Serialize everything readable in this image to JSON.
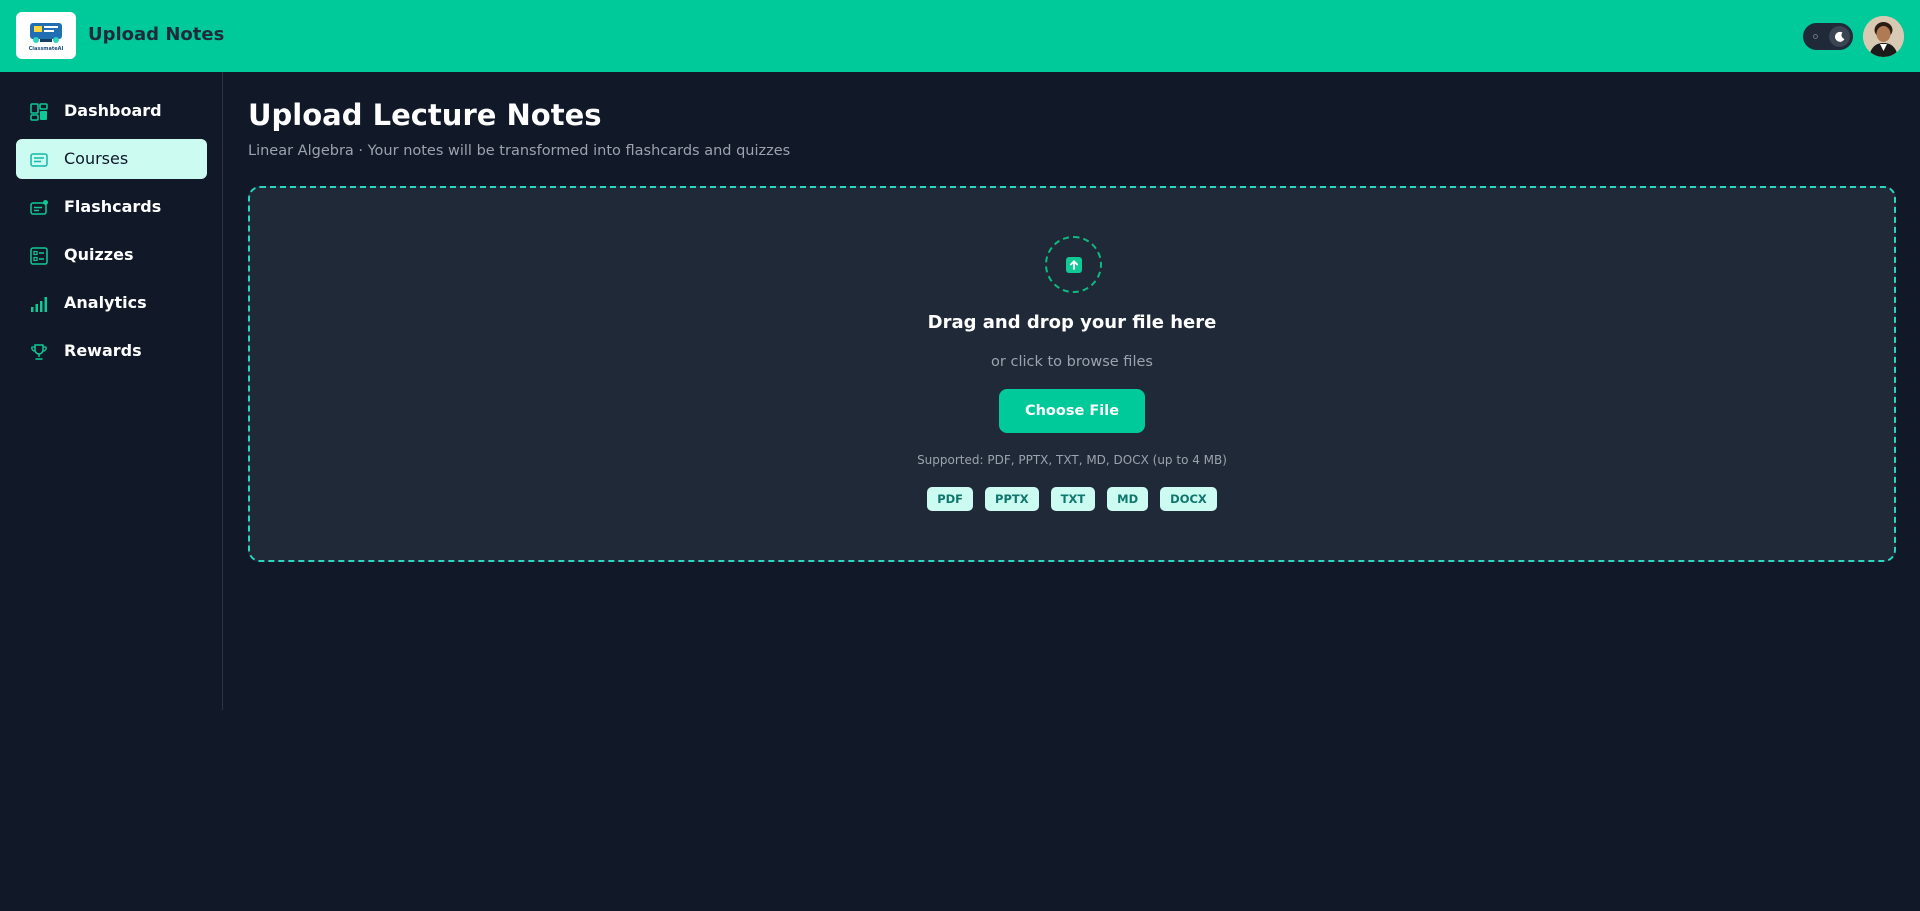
{
  "header": {
    "title": "Upload Notes",
    "logo_text": "ClassmateAI",
    "accent": "#00c99a"
  },
  "sidebar": {
    "items": [
      {
        "label": "Dashboard",
        "icon": "dashboard-icon",
        "active": false
      },
      {
        "label": "Courses",
        "icon": "courses-icon",
        "active": true
      },
      {
        "label": "Flashcards",
        "icon": "flashcards-icon",
        "active": false
      },
      {
        "label": "Quizzes",
        "icon": "quizzes-icon",
        "active": false
      },
      {
        "label": "Analytics",
        "icon": "analytics-icon",
        "active": false
      },
      {
        "label": "Rewards",
        "icon": "trophy-icon",
        "active": false
      }
    ]
  },
  "main": {
    "title": "Upload Lecture Notes",
    "subtitle": "Linear Algebra · Your notes will be transformed into flashcards and quizzes",
    "dropzone": {
      "title": "Drag and drop your file here",
      "subtitle": "or click to browse files",
      "button_label": "Choose File",
      "supported_text": "Supported: PDF, PPTX, TXT, MD, DOCX (up to 4 MB)",
      "file_types": [
        "PDF",
        "PPTX",
        "TXT",
        "MD",
        "DOCX"
      ]
    }
  },
  "colors": {
    "background": "#111827",
    "panel": "#1f2937",
    "accent": "#00c99a",
    "tag_bg": "#ccfbf1",
    "tag_text": "#0f766e"
  }
}
